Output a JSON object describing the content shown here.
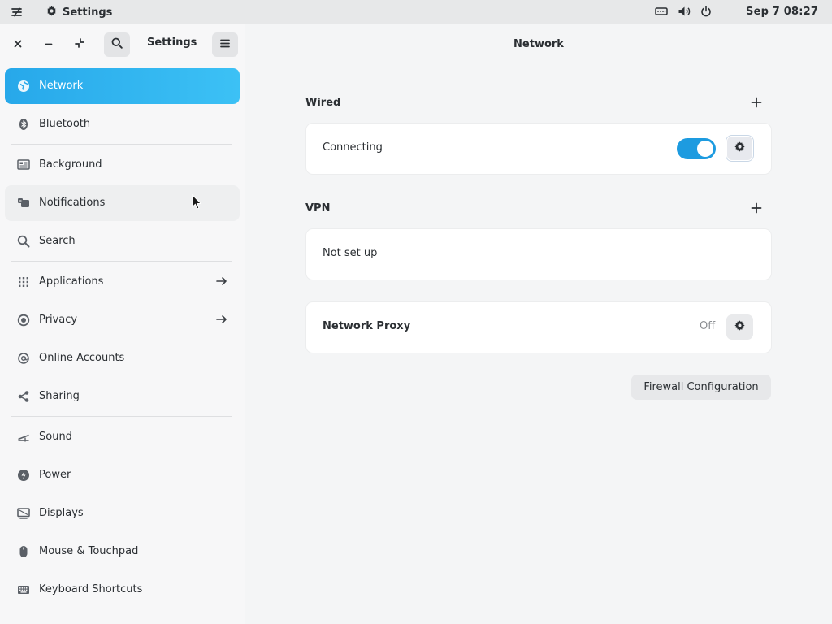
{
  "topbar": {
    "app_icon": "system-menu-icon",
    "window_title": "Settings",
    "window_icon": "gear-icon",
    "tray_icons": [
      "network-wired-icon",
      "volume-icon",
      "power-icon"
    ],
    "clock": "Sep 7  08:27"
  },
  "sidebar": {
    "title": "Settings",
    "header_buttons": [
      "close-icon",
      "minimize-icon",
      "restore-icon",
      "search-icon",
      "hamburger-menu-icon"
    ],
    "items": [
      {
        "label": "Network",
        "icon": "network-icon",
        "state": "selected"
      },
      {
        "label": "Bluetooth",
        "icon": "bluetooth-icon"
      },
      {
        "label": "Background",
        "icon": "background-icon"
      },
      {
        "label": "Notifications",
        "icon": "notifications-icon",
        "state": "hovered"
      },
      {
        "label": "Search",
        "icon": "search-icon"
      },
      {
        "label": "Applications",
        "icon": "applications-icon",
        "arrow": true
      },
      {
        "label": "Privacy",
        "icon": "privacy-icon",
        "arrow": true
      },
      {
        "label": "Online Accounts",
        "icon": "online-accounts-icon"
      },
      {
        "label": "Sharing",
        "icon": "sharing-icon"
      },
      {
        "label": "Sound",
        "icon": "sound-icon"
      },
      {
        "label": "Power",
        "icon": "power-icon"
      },
      {
        "label": "Displays",
        "icon": "displays-icon"
      },
      {
        "label": "Mouse & Touchpad",
        "icon": "mouse-icon"
      },
      {
        "label": "Keyboard Shortcuts",
        "icon": "keyboard-icon"
      }
    ]
  },
  "main": {
    "title": "Network",
    "wired": {
      "title": "Wired",
      "status": "Connecting",
      "toggle_on": true
    },
    "vpn": {
      "title": "VPN",
      "empty_text": "Not set up"
    },
    "proxy": {
      "label": "Network Proxy",
      "status": "Off"
    },
    "firewall_button": "Firewall Configuration"
  },
  "colors": {
    "accent": "#27a8ea",
    "toggle": "#1d9be0",
    "sidebar_bg": "#f7f7f8",
    "content_bg": "#f4f5f6",
    "card_bg": "#ffffff"
  }
}
